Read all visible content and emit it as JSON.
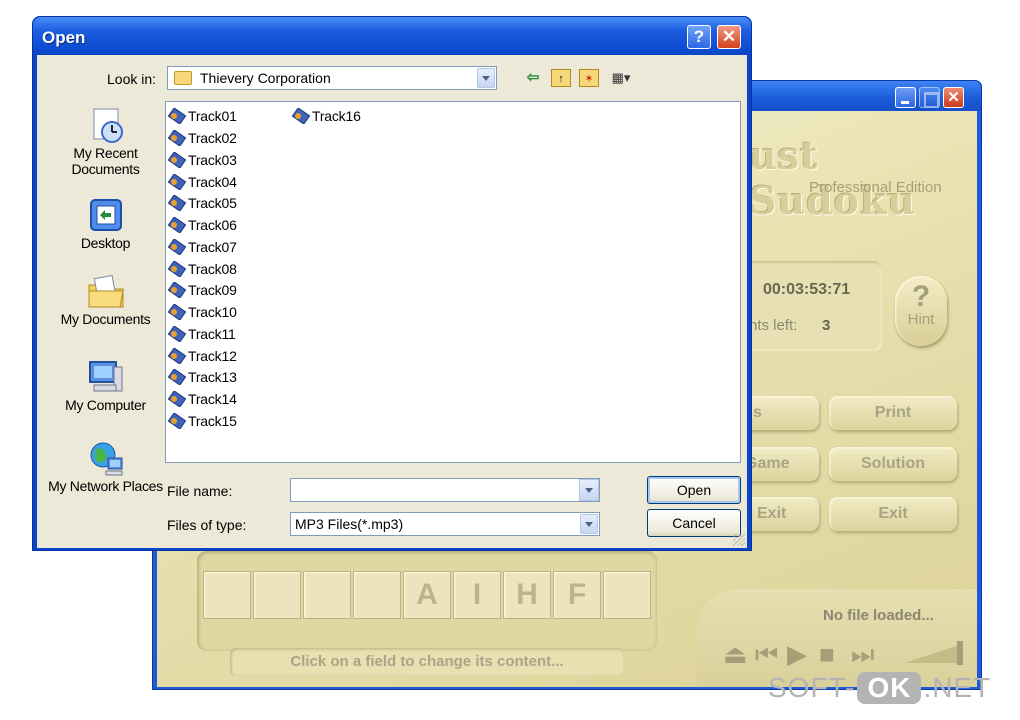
{
  "sudoku": {
    "logo": "ust Sudoku",
    "edition": "Professional Edition",
    "timer": "00:03:53:71",
    "hints_label": "nts left:",
    "hints_count": "3",
    "hint_q": "?",
    "hint_label": "Hint",
    "buttons": {
      "symbols": "bols",
      "print": "Print",
      "new_game": "Game",
      "solution": "Solution",
      "save_exit": "& Exit",
      "exit": "Exit"
    },
    "board_row": [
      "",
      "",
      "",
      "",
      "A",
      "I",
      "H",
      "F",
      ""
    ],
    "status": "Click on a field to change its content...",
    "player_status": "No file loaded..."
  },
  "dialog": {
    "title": "Open",
    "help_glyph": "?",
    "close_glyph": "✕",
    "look_in_label": "Look in:",
    "look_in_value": "Thievery Corporation",
    "places": {
      "recent": "My Recent Documents",
      "desktop": "Desktop",
      "documents": "My Documents",
      "computer": "My Computer",
      "network": "My Network Places"
    },
    "files": [
      "Track01",
      "Track02",
      "Track03",
      "Track04",
      "Track05",
      "Track06",
      "Track07",
      "Track08",
      "Track09",
      "Track10",
      "Track11",
      "Track12",
      "Track13",
      "Track14",
      "Track15",
      "Track16"
    ],
    "file_name_label": "File name:",
    "file_name_value": "",
    "files_of_type_label": "Files of type:",
    "files_of_type_value": "MP3 Files(*.mp3)",
    "open_button": "Open",
    "cancel_button": "Cancel"
  },
  "watermark": {
    "left": "SOFT-",
    "box": "OK",
    "right": ".NET"
  },
  "colors": {
    "xp_blue": "#0a44c8",
    "dialog_face": "#ece9d8",
    "sudoku_bg": "#e9e2b2",
    "watermark": "#b4b4b4"
  }
}
